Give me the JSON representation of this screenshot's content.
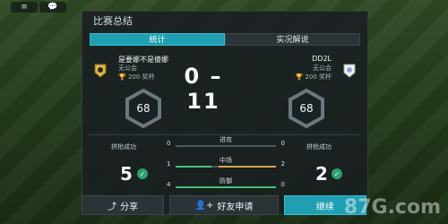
{
  "panel": {
    "title": "比赛总结"
  },
  "tabs": [
    {
      "label": "统计",
      "active": true
    },
    {
      "label": "实况解说",
      "active": false
    }
  ],
  "teams": {
    "left": {
      "name": "是要娜不是傻娜",
      "guild": "无公会",
      "cups": "200 奖杯",
      "rating": "68"
    },
    "right": {
      "name": "DD2L",
      "guild": "无公会",
      "cups": "200 奖杯",
      "rating": "68"
    }
  },
  "score": {
    "text": "0 – 11"
  },
  "stats": {
    "left": {
      "label": "拼抢成功",
      "value": "5"
    },
    "right": {
      "label": "拼抢成功",
      "value": "2"
    },
    "rows": [
      {
        "label": "进攻",
        "left": "0",
        "right": "0",
        "left_fraction": 0.0,
        "right_fraction": 0.0
      },
      {
        "label": "中场",
        "left": "1",
        "right": "2",
        "left_fraction": 0.33,
        "right_fraction": 0.67
      },
      {
        "label": "防御",
        "left": "4",
        "right": "0",
        "left_fraction": 1.0,
        "right_fraction": 0.0
      }
    ]
  },
  "actions": {
    "share": "分享",
    "friend": "好友申请",
    "continue": "继续"
  },
  "watermark": "87G.com"
}
